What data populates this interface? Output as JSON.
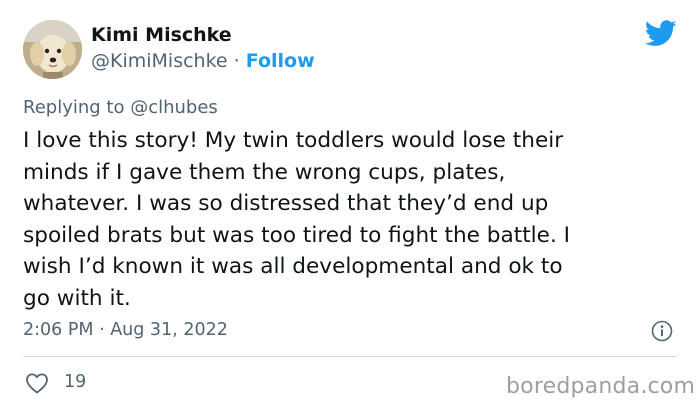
{
  "author": {
    "name": "Kimi Mischke",
    "handle": "@KimiMischke",
    "separator": "·",
    "follow_label": "Follow",
    "avatar_icon": "dog-avatar"
  },
  "brand": {
    "icon": "twitter-bird-icon",
    "color": "#1d9bf0"
  },
  "reply": {
    "prefix": "Replying to",
    "mention": "@clhubes"
  },
  "tweet": {
    "lines": [
      "I love this story! My twin toddlers would lose their",
      "minds if I gave them the wrong cups, plates,",
      "whatever. I was so distressed that they’d end up",
      "spoiled brats but was too tired to fight the battle. I",
      "wish I’d known it was all developmental and ok to",
      "go with it."
    ],
    "timestamp": "2:06 PM · Aug 31, 2022"
  },
  "actions": {
    "like_icon": "heart-icon",
    "like_count": "19",
    "info_icon": "info-icon"
  },
  "watermark": "boredpanda.com"
}
